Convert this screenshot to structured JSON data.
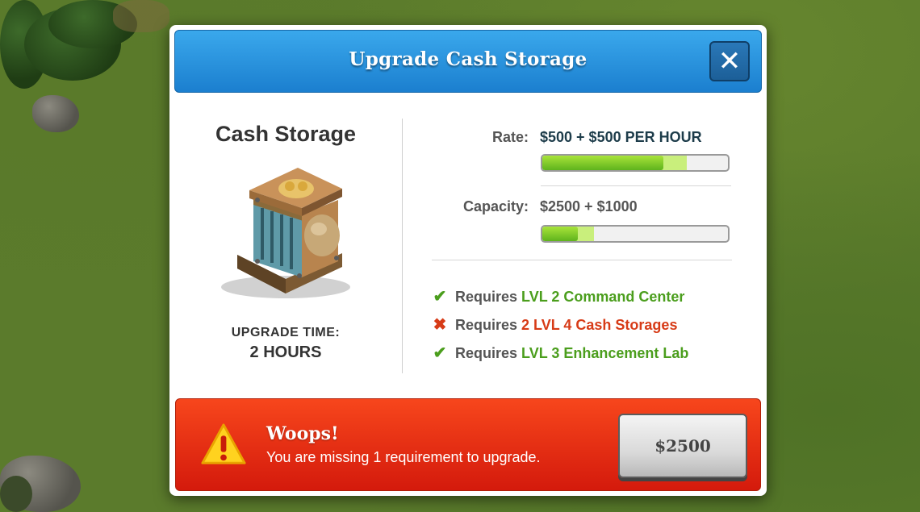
{
  "dialog": {
    "title": "Upgrade Cash Storage",
    "close_icon": "close-icon",
    "building": {
      "name": "Cash Storage",
      "upgrade_time_label": "UPGRADE TIME:",
      "upgrade_time_value": "2 HOURS"
    },
    "stats": {
      "rate": {
        "label": "Rate:",
        "value": "$500 + $500 PER HOUR",
        "current_fraction": 0.65,
        "upgrade_fraction": 0.78
      },
      "capacity": {
        "label": "Capacity:",
        "value": "$2500 + $1000",
        "current_fraction": 0.19,
        "upgrade_fraction": 0.28
      }
    },
    "requirements": [
      {
        "status": "met",
        "icon": "check-icon",
        "prefix": "Requires",
        "text": "LVL 2 Command Center"
      },
      {
        "status": "unmet",
        "icon": "cross-icon",
        "prefix": "Requires",
        "text": "2 LVL 4 Cash Storages"
      },
      {
        "status": "met",
        "icon": "check-icon",
        "prefix": "Requires",
        "text": "LVL 3 Enhancement Lab"
      }
    ],
    "alert": {
      "icon": "warning-icon",
      "title": "Woops!",
      "message": "You are missing 1 requirement to upgrade.",
      "cost_button_label": "$2500"
    },
    "colors": {
      "header_blue": "#1b7fcf",
      "met_green": "#4b9e1d",
      "unmet_red": "#d73b17",
      "alert_red": "#e02a10"
    }
  }
}
